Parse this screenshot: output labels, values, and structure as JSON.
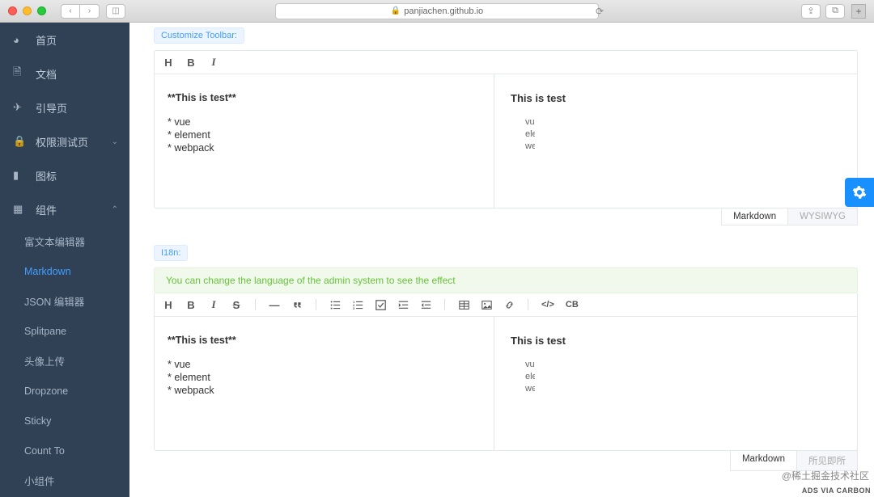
{
  "browser": {
    "url": "panjiachen.github.io"
  },
  "sidebar": {
    "items": [
      {
        "label": "首页",
        "icon": "dashboard"
      },
      {
        "label": "文档",
        "icon": "doc"
      },
      {
        "label": "引导页",
        "icon": "guide"
      },
      {
        "label": "权限测试页",
        "icon": "lock",
        "expandable": true
      },
      {
        "label": "图标",
        "icon": "icon"
      },
      {
        "label": "组件",
        "icon": "component",
        "expandable": true,
        "expanded": true
      }
    ],
    "sub": [
      {
        "label": "富文本编辑器"
      },
      {
        "label": "Markdown",
        "active": true
      },
      {
        "label": "JSON 编辑器"
      },
      {
        "label": "Splitpane"
      },
      {
        "label": "头像上传"
      },
      {
        "label": "Dropzone"
      },
      {
        "label": "Sticky"
      },
      {
        "label": "Count To"
      },
      {
        "label": "小组件"
      }
    ]
  },
  "section1": {
    "tag": "Customize Toolbar:",
    "source_bold": "**This is test**",
    "source_items": [
      "* vue",
      "* element",
      "* webpack"
    ],
    "preview_heading": "This is test",
    "preview_items": [
      "vue",
      "element",
      "webpack"
    ],
    "tabs": {
      "active": "Markdown",
      "inactive": "WYSIWYG"
    }
  },
  "section2": {
    "tag": "I18n:",
    "alert": "You can change the language of the admin system to see the effect",
    "source_bold": "**This is test**",
    "source_items": [
      "* vue",
      "* element",
      "* webpack"
    ],
    "preview_heading": "This is test",
    "preview_items": [
      "vue",
      "element",
      "webpack"
    ],
    "tabs": {
      "active": "Markdown",
      "inactive": "所见即所"
    }
  },
  "footer": {
    "watermark": "@稀土掘金技术社区",
    "ads": "ADS VIA CARBON"
  },
  "toolbar_labels": {
    "H": "H",
    "B": "B",
    "I": "I",
    "S": "S",
    "CB": "CB"
  }
}
